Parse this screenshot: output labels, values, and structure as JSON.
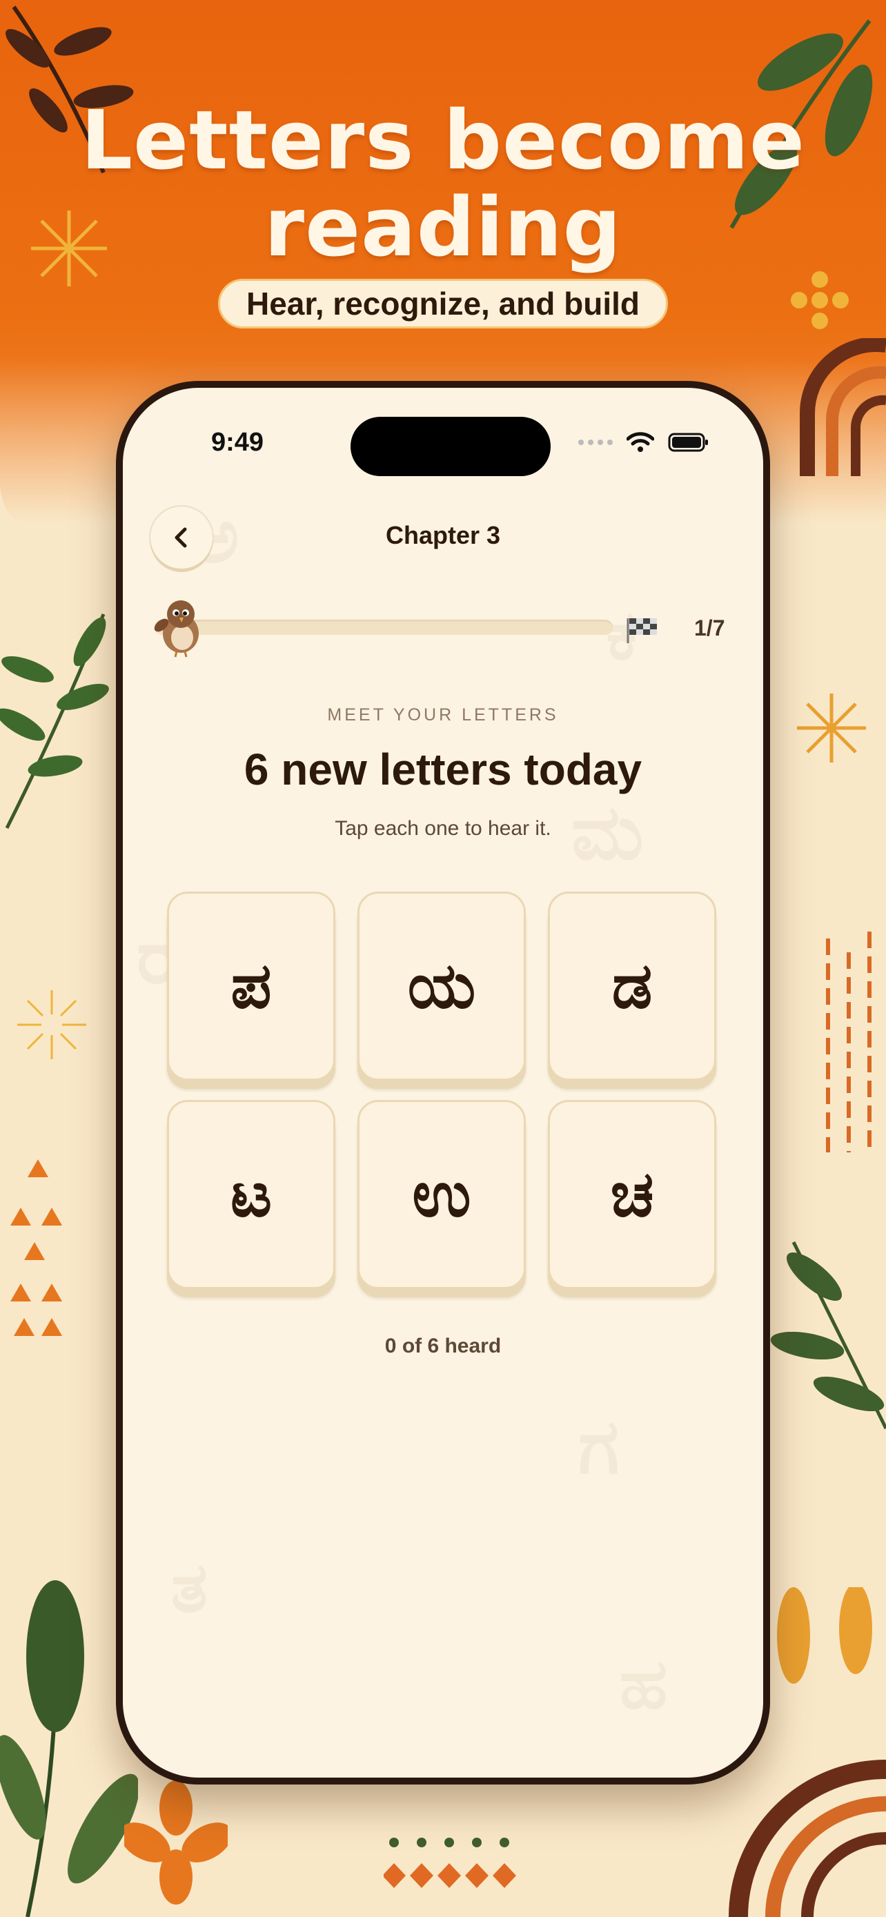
{
  "promo": {
    "headline_line1": "Letters become",
    "headline_line2": "reading",
    "subtitle": "Hear, recognize, and build"
  },
  "status_bar": {
    "time": "9:49"
  },
  "nav": {
    "title": "Chapter 3",
    "back_icon": "chevron-left-icon"
  },
  "progress": {
    "current": 1,
    "total": 7,
    "label": "1/7",
    "mascot_icon": "sparrow-mascot-icon",
    "finish_icon": "checkered-flag-icon"
  },
  "intro": {
    "eyebrow": "MEET YOUR LETTERS",
    "title": "6 new letters today",
    "instruction": "Tap each one to hear it."
  },
  "letters": [
    {
      "glyph": "ಪ"
    },
    {
      "glyph": "ಯ"
    },
    {
      "glyph": "ಡ"
    },
    {
      "glyph": "ಟ"
    },
    {
      "glyph": "ಉ"
    },
    {
      "glyph": "ಚ"
    }
  ],
  "heard_status": "0 of 6 heard",
  "colors": {
    "accent_orange": "#e8640e",
    "cream": "#fcf3e2",
    "ink": "#2d1a0c"
  }
}
